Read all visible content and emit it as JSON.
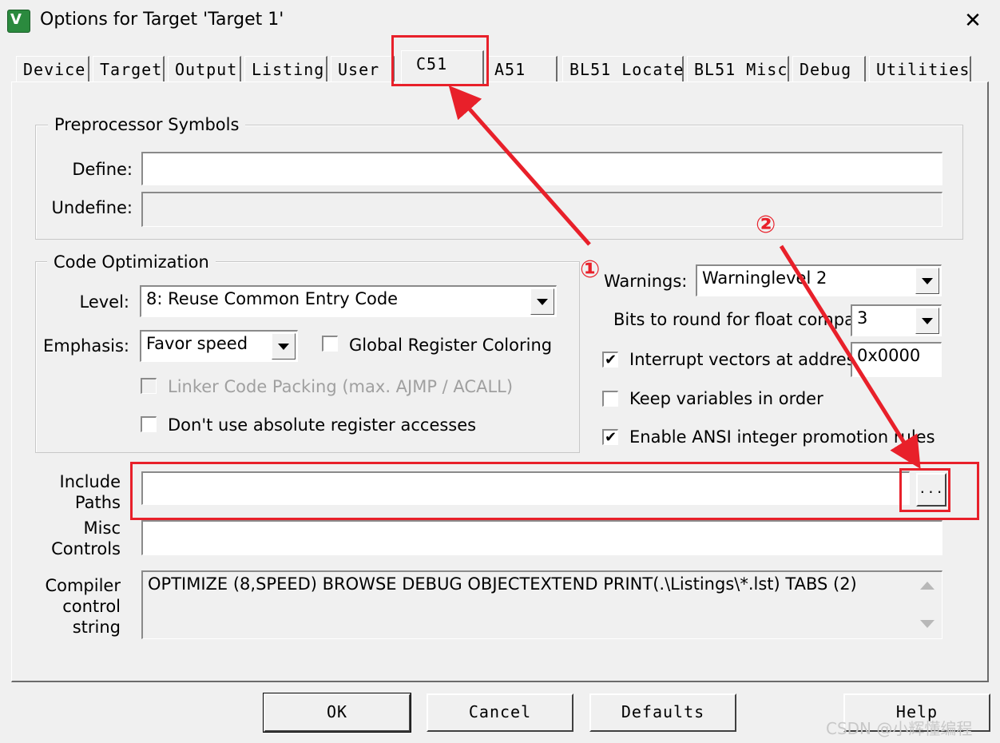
{
  "window": {
    "title": "Options for Target 'Target 1'",
    "close_glyph": "✕",
    "app_icon": "uvision-icon"
  },
  "tabs": [
    "Device",
    "Target",
    "Output",
    "Listing",
    "User",
    "C51",
    "A51",
    "BL51 Locate",
    "BL51 Misc",
    "Debug",
    "Utilities"
  ],
  "active_tab": "C51",
  "preprocessor": {
    "title": "Preprocessor Symbols",
    "define_label": "Define:",
    "define_value": "",
    "undefine_label": "Undefine:",
    "undefine_value": ""
  },
  "code_optimization": {
    "title": "Code Optimization",
    "level_label": "Level:",
    "level_value": "8: Reuse Common Entry Code",
    "emphasis_label": "Emphasis:",
    "emphasis_value": "Favor speed",
    "global_register_coloring": {
      "label": "Global Register Coloring",
      "checked": false
    },
    "linker_code_packing": {
      "label": "Linker Code Packing (max. AJMP / ACALL)",
      "checked": false,
      "disabled": true
    },
    "no_absolute_register": {
      "label": "Don't use absolute register accesses",
      "checked": false
    }
  },
  "right_options": {
    "warnings_label": "Warnings:",
    "warnings_value": "Warninglevel 2",
    "bits_round_label": "Bits to round for float compare:",
    "bits_round_value": "3",
    "interrupt_vectors": {
      "label": "Interrupt vectors at address:",
      "checked": true,
      "value": "0x0000"
    },
    "keep_variables": {
      "label": "Keep variables in order",
      "checked": false
    },
    "ansi_promotion": {
      "label": "Enable ANSI integer promotion rules",
      "checked": true
    }
  },
  "include_paths": {
    "label_line1": "Include",
    "label_line2": "Paths",
    "value": "",
    "browse_label": "..."
  },
  "misc_controls": {
    "label_line1": "Misc",
    "label_line2": "Controls",
    "value": ""
  },
  "compiler_string": {
    "label_line1": "Compiler",
    "label_line2": "control",
    "label_line3": "string",
    "value": "OPTIMIZE (8,SPEED) BROWSE DEBUG OBJECTEXTEND PRINT(.\\Listings\\*.lst) TABS (2)"
  },
  "buttons": {
    "ok": "OK",
    "cancel": "Cancel",
    "defaults": "Defaults",
    "help": "Help"
  },
  "annotations": {
    "marker_1": "①",
    "marker_2": "②",
    "color": "#e8202a"
  },
  "watermark": "CSDN @小辉懂编程"
}
